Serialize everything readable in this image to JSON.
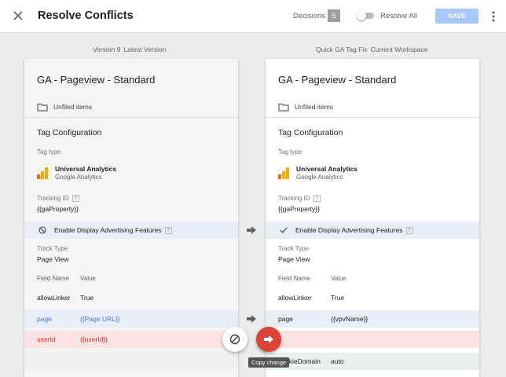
{
  "header": {
    "title": "Resolve Conflicts",
    "decisions_label": "Decisions",
    "decisions_count": "5",
    "resolve_all_label": "Resolve All",
    "save_label": "SAVE"
  },
  "left": {
    "version_label": "Version 9",
    "version_sub": "Latest Version",
    "tag_name": "GA - Pageview - Standard",
    "folder": "Unfiled items",
    "section": "Tag Configuration",
    "tag_type_label": "Tag type",
    "tag_type_name": "Universal Analytics",
    "tag_type_sub": "Google Analytics",
    "tracking_id_label": "Tracking ID",
    "tracking_id_value": "{{gaProperty}}",
    "advertising_label": "Enable Display Advertising Features",
    "track_type_label": "Track Type",
    "track_type_value": "Page View",
    "field_name_header": "Field Name",
    "value_header": "Value",
    "fields": [
      {
        "name": "allowLinker",
        "value": "True"
      },
      {
        "name": "page",
        "value": "{{Page URL}}"
      },
      {
        "name": "userId",
        "value": "{{userId}}"
      }
    ]
  },
  "right": {
    "version_label": "Quick GA Tag Fix",
    "version_sub": "Current Workspace",
    "tag_name": "GA - Pageview - Standard",
    "folder": "Unfiled items",
    "section": "Tag Configuration",
    "tag_type_label": "Tag type",
    "tag_type_name": "Universal Analytics",
    "tag_type_sub": "Google Analytics",
    "tracking_id_label": "Tracking ID",
    "tracking_id_value": "{{gaProperty}}",
    "advertising_label": "Enable Display Advertising Features",
    "track_type_label": "Track Type",
    "track_type_value": "Page View",
    "field_name_header": "Field Name",
    "value_header": "Value",
    "fields": [
      {
        "name": "allowLinker",
        "value": "True"
      },
      {
        "name": "page",
        "value": "{{vpvName}}"
      },
      {
        "name": "cookieDomain",
        "value": "auto"
      }
    ]
  },
  "tooltip": "Copy change",
  "help_glyph": "?",
  "colors": {
    "accent": "#a8c7fa",
    "copy_fab": "#db4437",
    "link_blue": "#4a77c9",
    "removed_red": "#d93025",
    "removed_bg": "#fbe3e3",
    "changed_bg": "#e8eef8",
    "added_bg": "#e6f1eb",
    "analytics_orange": "#f9ab00"
  }
}
